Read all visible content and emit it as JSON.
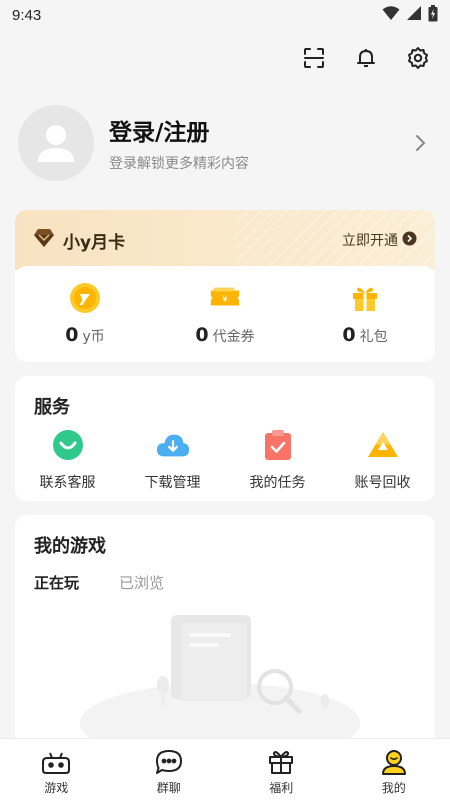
{
  "status_bar": {
    "time": "9:43"
  },
  "top_actions": {
    "icons": [
      "scan-icon",
      "bell-icon",
      "gear-icon"
    ]
  },
  "profile": {
    "title": "登录/注册",
    "subtitle": "登录解锁更多精彩内容"
  },
  "member_card": {
    "title": "小y月卡",
    "open_label": "立即开通",
    "stats": [
      {
        "value": "0",
        "unit": "y币",
        "icon": "ycoin-icon"
      },
      {
        "value": "0",
        "unit": "代金券",
        "icon": "voucher-icon"
      },
      {
        "value": "0",
        "unit": "礼包",
        "icon": "gift-icon"
      }
    ]
  },
  "services": {
    "title": "服务",
    "items": [
      {
        "label": "联系客服",
        "icon": "customer-service-icon"
      },
      {
        "label": "下载管理",
        "icon": "download-cloud-icon"
      },
      {
        "label": "我的任务",
        "icon": "task-clipboard-icon"
      },
      {
        "label": "账号回收",
        "icon": "account-recycle-icon"
      }
    ]
  },
  "my_games": {
    "title": "我的游戏",
    "tabs": [
      {
        "label": "正在玩",
        "active": true
      },
      {
        "label": "已浏览",
        "active": false
      }
    ]
  },
  "bottom_nav": {
    "items": [
      {
        "label": "游戏",
        "icon": "gamepad-icon"
      },
      {
        "label": "群聊",
        "icon": "chat-icon"
      },
      {
        "label": "福利",
        "icon": "gift-box-icon"
      },
      {
        "label": "我的",
        "icon": "profile-icon",
        "active": true
      }
    ]
  },
  "colors": {
    "accent": "#ffd21e",
    "member_gradient": "#f8e3c1",
    "background": "#f5f5f5"
  }
}
